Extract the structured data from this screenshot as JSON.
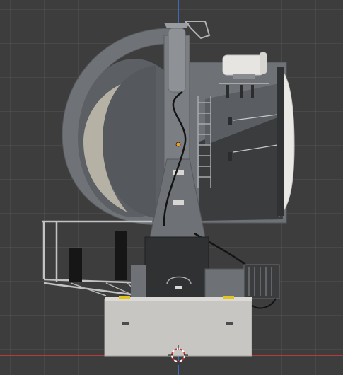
{
  "viewport": {
    "view": "front-orthographic",
    "background_color": "#3d3d3d",
    "grid_color": "#4a4a4a",
    "axis_x_color": "#b53a3a",
    "axis_z_color": "#3a6db5",
    "selected_origin_color": "#f0a020",
    "cursor_colors": [
      "#d43030",
      "#ffffff"
    ]
  },
  "scene": {
    "object": "turbine-engine-assembly-on-stand",
    "colors": {
      "body": "#6e7276",
      "dark_panel": "#2f3133",
      "intake_ring": "#7a7d80",
      "intake_face": "#b7b3a8",
      "base_block": "#c8c6c2",
      "hazard_marker": "#e3c41a",
      "platform_rail": "#c0c2c4",
      "hose": "#1a1a1a"
    }
  }
}
